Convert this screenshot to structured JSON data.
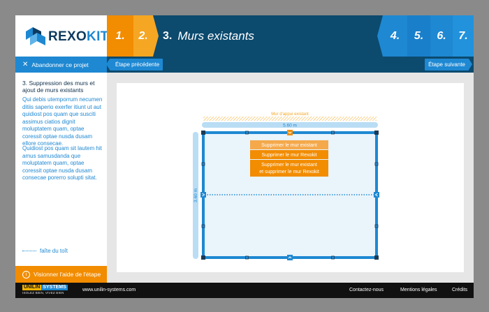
{
  "brand": {
    "logo_part1": "REXO",
    "logo_part2": "KIT"
  },
  "steps": [
    {
      "num": "1."
    },
    {
      "num": "2."
    },
    {
      "num": "3.",
      "title": "Murs existants"
    },
    {
      "num": "4."
    },
    {
      "num": "5."
    },
    {
      "num": "6."
    },
    {
      "num": "7."
    }
  ],
  "nav": {
    "abandon": "Abandonner ce projet",
    "prev": "Étape précédente",
    "next": "Étape suivante"
  },
  "sidebar": {
    "heading": "3. Suppression des murs et ajout de murs existants",
    "p1": " Qui debis utemporrum necumen ditiis saperio exerfer itiunt ut aut quidiost pos quam que susciti assimus ciatios dignit moluptatem quam, optae coressit optae nusda dusam ellore consecae.",
    "p2": "Quidiost pos quam sit lautem hit amus samusdanda que moluptatem quam, optae coressit optae nusda dusam consecae porerro solupti sitat.",
    "legend": "faîte du toît",
    "help": "Visionner l'aide de l'étape"
  },
  "plan": {
    "bearing_wall_label": "Mur d'appui existant",
    "width_label": "5.60 m",
    "height_label": "3.60 m",
    "menu": [
      "Supprimer le mur existant",
      "Supprimer le mur Rexokit",
      "Supprimer le mur existant",
      "et supprimer le mur Rexokit"
    ]
  },
  "footer": {
    "brand1": "UNILIN",
    "brand2": "SYSTEMS",
    "tagline": "ISOLEZ BIEN, VIVEZ BIEN",
    "site": "www.unilin-systems.com",
    "contact": "Contactez-nous",
    "legal": "Mentions légales",
    "credits": "Crédits"
  },
  "colors": {
    "orange": "#f28c00",
    "blue": "#1e88d2",
    "navy": "#0c4a6e"
  }
}
